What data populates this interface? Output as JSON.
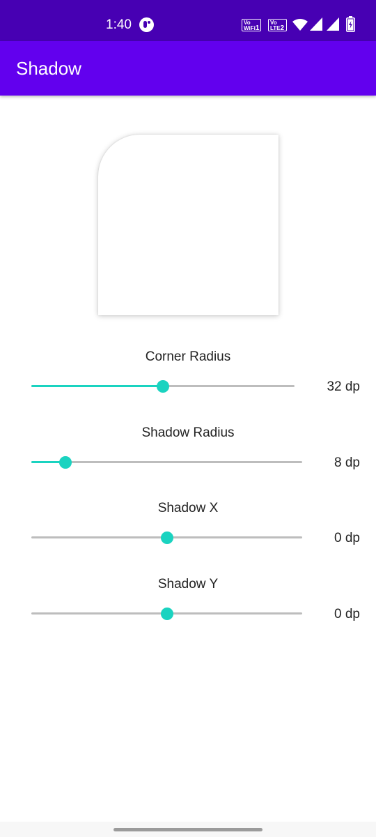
{
  "status_bar": {
    "time": "1:40",
    "badge1_top": "Vo",
    "badge1_bottom": "WiFi",
    "badge1_sub": "1",
    "badge2_top": "Vo",
    "badge2_bottom": "LTE",
    "badge2_sub": "2",
    "icons": [
      "app-notification-icon",
      "volte-wifi-icon",
      "volte-lte-icon",
      "wifi-icon",
      "signal-icon",
      "signal-icon",
      "battery-charging-icon"
    ]
  },
  "app_bar": {
    "title": "Shadow",
    "color": "#6200ee"
  },
  "colors": {
    "accent": "#1ad3c0",
    "status_bar": "#4700b3",
    "track": "#bdbdbd"
  },
  "controls": [
    {
      "label": "Corner Radius",
      "value": "32 dp",
      "fraction": 0.5
    },
    {
      "label": "Shadow Radius",
      "value": "8 dp",
      "fraction": 0.125
    },
    {
      "label": "Shadow X",
      "value": "0 dp",
      "fraction": 0.5
    },
    {
      "label": "Shadow Y",
      "value": "0 dp",
      "fraction": 0.5
    }
  ]
}
